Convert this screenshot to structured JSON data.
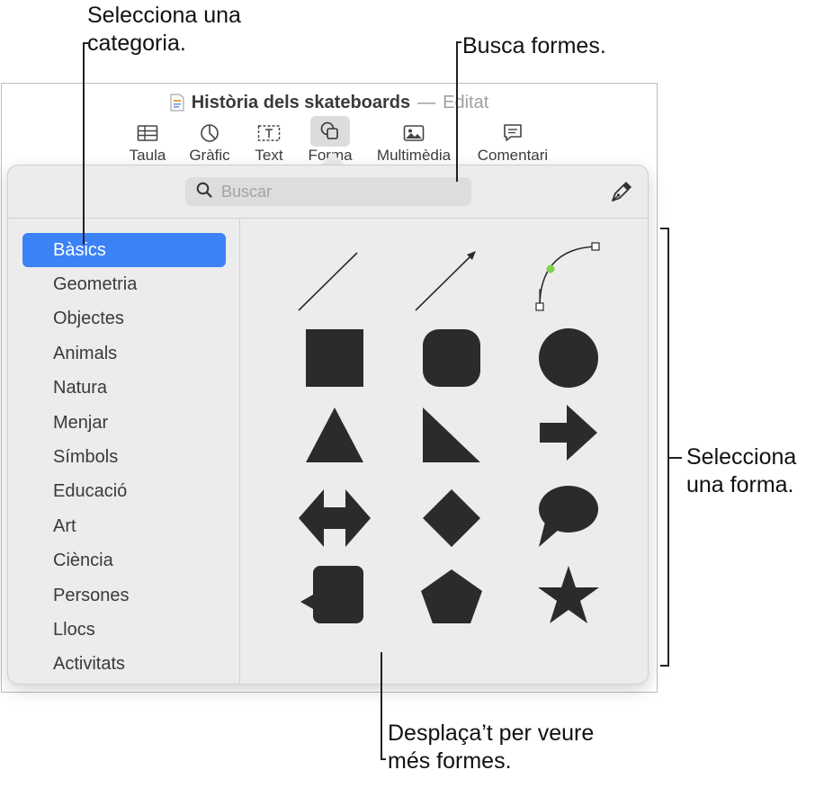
{
  "callouts": {
    "category": [
      "Selecciona una",
      "categoria."
    ],
    "search": [
      "Busca formes."
    ],
    "shape": [
      "Selecciona",
      "una forma."
    ],
    "scroll": [
      "Desplaça’t per veure",
      "més formes."
    ]
  },
  "window": {
    "title": "Història dels skateboards",
    "separator": "—",
    "status": "Editat"
  },
  "toolbar": {
    "items": [
      {
        "label": "Taula",
        "icon": "table-icon"
      },
      {
        "label": "Gràfic",
        "icon": "chart-icon"
      },
      {
        "label": "Text",
        "icon": "text-box-icon"
      },
      {
        "label": "Forma",
        "icon": "shape-icon"
      },
      {
        "label": "Multimèdia",
        "icon": "media-icon"
      },
      {
        "label": "Comentari",
        "icon": "comment-icon"
      }
    ],
    "active": "Forma"
  },
  "popover": {
    "search_placeholder": "Buscar",
    "categories": [
      "Bàsics",
      "Geometria",
      "Objectes",
      "Animals",
      "Natura",
      "Menjar",
      "Símbols",
      "Educació",
      "Art",
      "Ciència",
      "Persones",
      "Llocs",
      "Activitats"
    ],
    "selected_category": "Bàsics",
    "shapes": [
      "line",
      "arrow-line",
      "curve",
      "square",
      "rounded-square",
      "circle",
      "triangle",
      "right-triangle",
      "arrow",
      "double-arrow",
      "diamond",
      "speech-bubble",
      "callout-square",
      "pentagon",
      "star"
    ]
  },
  "colors": {
    "accent": "#3b82f6",
    "shape_fill": "#2b2b2b",
    "popover_bg": "#ececec",
    "curve_point": "#7dd34f"
  }
}
